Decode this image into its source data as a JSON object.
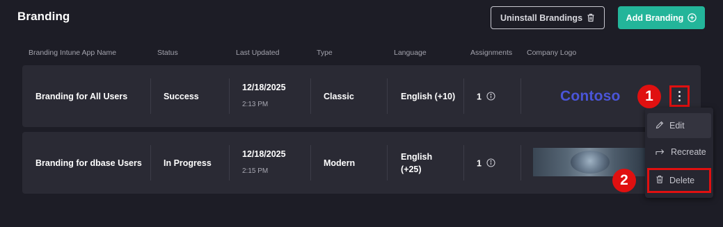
{
  "header": {
    "title": "Branding",
    "uninstall_label": "Uninstall Brandings",
    "add_label": "Add Branding"
  },
  "table": {
    "columns": [
      "Branding Intune App Name",
      "Status",
      "Last Updated",
      "Type",
      "Language",
      "Assignments",
      "Company Logo"
    ],
    "rows": [
      {
        "name": "Branding for All Users",
        "status": "Success",
        "date": "12/18/2025",
        "time": "2:13 PM",
        "type": "Classic",
        "language_line1": "English (+10)",
        "language_line2": "",
        "assignments": "1",
        "logo_text": "Contoso"
      },
      {
        "name": "Branding for dbase Users",
        "status": "In Progress",
        "date": "12/18/2025",
        "time": "2:15 PM",
        "type": "Modern",
        "language_line1": "English",
        "language_line2": "(+25)",
        "assignments": "1",
        "logo_text": ""
      }
    ]
  },
  "menu": {
    "items": [
      "Edit",
      "Recreate",
      "Delete"
    ]
  },
  "annotations": [
    "1",
    "2"
  ],
  "colors": {
    "background": "#1d1d26",
    "row": "#2a2a34",
    "accent": "#23b59a",
    "highlight": "#e01010",
    "contoso": "#4a55d8"
  },
  "icons": {
    "uninstall": "trash-icon",
    "add": "plus-circle-icon",
    "assignments": "info-icon",
    "row_menu": "kebab-menu-icon",
    "edit": "pencil-icon",
    "recreate": "share-arrow-icon",
    "delete": "trash-icon"
  }
}
